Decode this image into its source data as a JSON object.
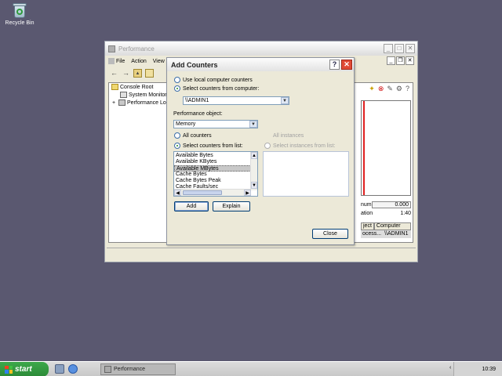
{
  "desktop": {
    "recycle_bin_label": "Recycle Bin"
  },
  "perf_window": {
    "title": "Performance",
    "menu": [
      "File",
      "Action",
      "View"
    ],
    "tree": {
      "root": "Console Root",
      "children": [
        "System Monitor",
        "Performance Logs"
      ]
    },
    "stats": {
      "maximum_label": "num",
      "maximum_value": "0.000",
      "duration_label": "ation",
      "duration_value": "1:40"
    },
    "legend": {
      "col_object": "ject",
      "col_computer": "Computer",
      "row_object": "ocess...",
      "row_computer": "\\\\ADMIN1"
    }
  },
  "dialog": {
    "title": "Add Counters",
    "help": "?",
    "close": "✕",
    "use_local": "Use local computer counters",
    "select_from_computer": "Select counters from computer:",
    "computer_value": "\\\\ADMIN1",
    "perf_object_label": "Performance object:",
    "perf_object_value": "Memory",
    "all_counters": "All counters",
    "select_counters_from_list": "Select counters from list:",
    "all_instances": "All instances",
    "select_instances_from_list": "Select instances from list:",
    "counters": [
      "Available Bytes",
      "Available KBytes",
      "Available MBytes",
      "Cache Bytes",
      "Cache Bytes Peak",
      "Cache Faults/sec"
    ],
    "selected_counter_index": 2,
    "add_button": "Add",
    "explain_button": "Explain",
    "close_button": "Close"
  },
  "taskbar": {
    "start": "start",
    "task_label": "Performance",
    "lang": "EN",
    "clock": "10:39"
  }
}
